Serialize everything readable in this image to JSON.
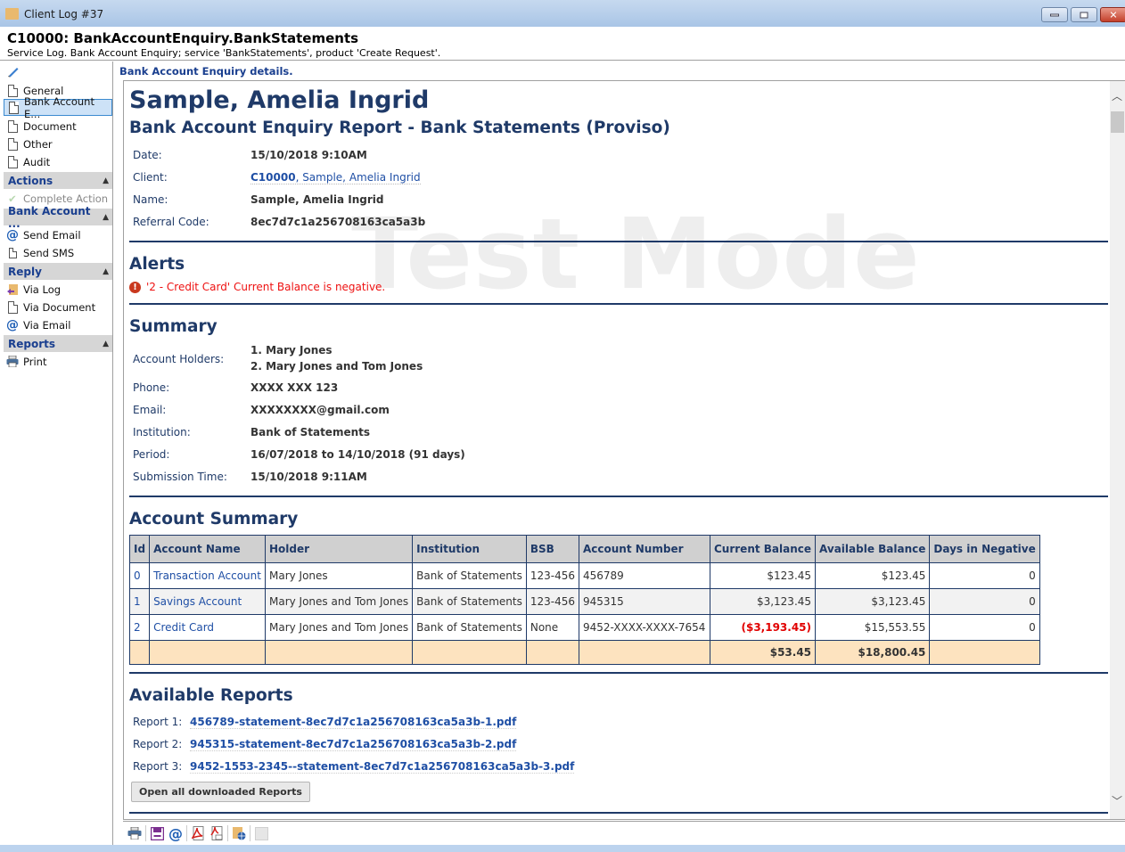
{
  "window": {
    "title": "Client Log #37",
    "controls": [
      "minimize",
      "maximize",
      "close"
    ]
  },
  "header": {
    "title": "C10000: BankAccountEnquiry.BankStatements",
    "subtitle": "Service Log. Bank Account Enquiry; service 'BankStatements', product 'Create Request'."
  },
  "sidebar": {
    "edit_icon": "pencil-icon",
    "pages": [
      {
        "label": "General",
        "icon": "document-icon",
        "selected": false
      },
      {
        "label": "Bank Account E...",
        "icon": "document-icon",
        "selected": true
      },
      {
        "label": "Document",
        "icon": "document-icon",
        "selected": false
      },
      {
        "label": "Other",
        "icon": "document-icon",
        "selected": false
      },
      {
        "label": "Audit",
        "icon": "audit-document-icon",
        "selected": false
      }
    ],
    "sections": [
      {
        "title": "Actions",
        "items": [
          {
            "label": "Complete Action",
            "icon": "checkmark-icon",
            "disabled": true
          }
        ]
      },
      {
        "title": "Bank Account ...",
        "items": [
          {
            "label": "Send Email",
            "icon": "at-icon"
          },
          {
            "label": "Send SMS",
            "icon": "sms-icon"
          }
        ]
      },
      {
        "title": "Reply",
        "items": [
          {
            "label": "Via Log",
            "icon": "reply-log-icon"
          },
          {
            "label": "Via Document",
            "icon": "text-document-icon"
          },
          {
            "label": "Via Email",
            "icon": "at-icon"
          }
        ]
      },
      {
        "title": "Reports",
        "items": [
          {
            "label": "Print",
            "icon": "printer-icon"
          }
        ]
      }
    ]
  },
  "content": {
    "label": "Bank Account Enquiry details.",
    "watermark": "Test Mode",
    "client_name": "Sample, Amelia Ingrid",
    "report_title": "Bank Account Enquiry Report - Bank Statements (Proviso)",
    "details": {
      "date": {
        "label": "Date:",
        "value": "15/10/2018 9:10AM"
      },
      "client": {
        "label": "Client:",
        "id": "C10000",
        "name": ", Sample, Amelia Ingrid"
      },
      "name": {
        "label": "Name:",
        "value": "Sample, Amelia Ingrid"
      },
      "referral": {
        "label": "Referral Code:",
        "value": "8ec7d7c1a256708163ca5a3b"
      }
    },
    "alerts": {
      "title": "Alerts",
      "items": [
        "'2 - Credit Card' Current Balance is negative."
      ]
    },
    "summary": {
      "title": "Summary",
      "holders_label": "Account Holders:",
      "holders": [
        "1. Mary Jones",
        "2. Mary Jones and Tom Jones"
      ],
      "phone": {
        "label": "Phone:",
        "value": "XXXX XXX 123"
      },
      "email": {
        "label": "Email:",
        "value": "XXXXXXXX@gmail.com"
      },
      "institution": {
        "label": "Institution:",
        "value": "Bank of Statements"
      },
      "period": {
        "label": "Period:",
        "value": "16/07/2018 to 14/10/2018 (91 days)"
      },
      "submission": {
        "label": "Submission Time:",
        "value": "15/10/2018 9:11AM"
      }
    },
    "account_summary": {
      "title": "Account Summary",
      "columns": [
        "Id",
        "Account Name",
        "Holder",
        "Institution",
        "BSB",
        "Account Number",
        "Current Balance",
        "Available Balance",
        "Days in Negative"
      ],
      "rows": [
        {
          "id": "0",
          "name": "Transaction Account",
          "holder": "Mary Jones",
          "institution": "Bank of Statements",
          "bsb": "123-456",
          "number": "456789",
          "current": "$123.45",
          "available": "$123.45",
          "days": "0",
          "negative": false
        },
        {
          "id": "1",
          "name": "Savings Account",
          "holder": "Mary Jones and Tom Jones",
          "institution": "Bank of Statements",
          "bsb": "123-456",
          "number": "945315",
          "current": "$3,123.45",
          "available": "$3,123.45",
          "days": "0",
          "negative": false
        },
        {
          "id": "2",
          "name": "Credit Card",
          "holder": "Mary Jones and Tom Jones",
          "institution": "Bank of Statements",
          "bsb": "None",
          "number": "9452-XXXX-XXXX-7654",
          "current": "($3,193.45)",
          "available": "$15,553.55",
          "days": "0",
          "negative": true
        }
      ],
      "totals": {
        "current": "$53.45",
        "available": "$18,800.45"
      }
    },
    "available_reports": {
      "title": "Available Reports",
      "items": [
        {
          "label": "Report 1:",
          "file": "456789-statement-8ec7d7c1a256708163ca5a3b-1.pdf"
        },
        {
          "label": "Report 2:",
          "file": "945315-statement-8ec7d7c1a256708163ca5a3b-2.pdf"
        },
        {
          "label": "Report 3:",
          "file": "9452-1553-2345--statement-8ec7d7c1a256708163ca5a3b-3.pdf"
        }
      ],
      "open_all_label": "Open all downloaded Reports"
    }
  },
  "toolbar": {
    "buttons": [
      "printer-icon",
      "save-icon",
      "email-icon",
      "pdf-icon",
      "pdf-email-icon",
      "web-export-icon",
      "blank-icon"
    ]
  },
  "colors": {
    "heading": "#1f3a68",
    "link": "#1f4fa5",
    "alert": "#e11111",
    "total_row": "#fde3bf",
    "section_header_text": "#1a3f8f"
  }
}
